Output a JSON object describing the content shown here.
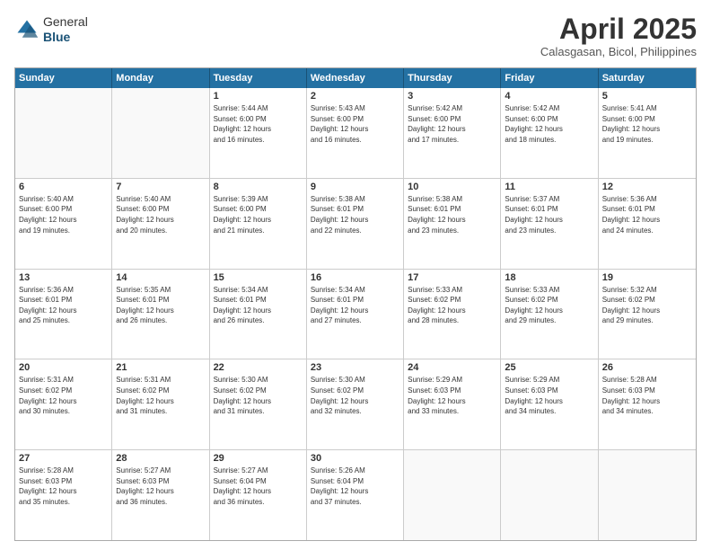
{
  "logo": {
    "general": "General",
    "blue": "Blue"
  },
  "header": {
    "month": "April 2025",
    "location": "Calasgasan, Bicol, Philippines"
  },
  "weekdays": [
    "Sunday",
    "Monday",
    "Tuesday",
    "Wednesday",
    "Thursday",
    "Friday",
    "Saturday"
  ],
  "rows": [
    [
      {
        "date": "",
        "info": ""
      },
      {
        "date": "",
        "info": ""
      },
      {
        "date": "1",
        "info": "Sunrise: 5:44 AM\nSunset: 6:00 PM\nDaylight: 12 hours\nand 16 minutes."
      },
      {
        "date": "2",
        "info": "Sunrise: 5:43 AM\nSunset: 6:00 PM\nDaylight: 12 hours\nand 16 minutes."
      },
      {
        "date": "3",
        "info": "Sunrise: 5:42 AM\nSunset: 6:00 PM\nDaylight: 12 hours\nand 17 minutes."
      },
      {
        "date": "4",
        "info": "Sunrise: 5:42 AM\nSunset: 6:00 PM\nDaylight: 12 hours\nand 18 minutes."
      },
      {
        "date": "5",
        "info": "Sunrise: 5:41 AM\nSunset: 6:00 PM\nDaylight: 12 hours\nand 19 minutes."
      }
    ],
    [
      {
        "date": "6",
        "info": "Sunrise: 5:40 AM\nSunset: 6:00 PM\nDaylight: 12 hours\nand 19 minutes."
      },
      {
        "date": "7",
        "info": "Sunrise: 5:40 AM\nSunset: 6:00 PM\nDaylight: 12 hours\nand 20 minutes."
      },
      {
        "date": "8",
        "info": "Sunrise: 5:39 AM\nSunset: 6:00 PM\nDaylight: 12 hours\nand 21 minutes."
      },
      {
        "date": "9",
        "info": "Sunrise: 5:38 AM\nSunset: 6:01 PM\nDaylight: 12 hours\nand 22 minutes."
      },
      {
        "date": "10",
        "info": "Sunrise: 5:38 AM\nSunset: 6:01 PM\nDaylight: 12 hours\nand 23 minutes."
      },
      {
        "date": "11",
        "info": "Sunrise: 5:37 AM\nSunset: 6:01 PM\nDaylight: 12 hours\nand 23 minutes."
      },
      {
        "date": "12",
        "info": "Sunrise: 5:36 AM\nSunset: 6:01 PM\nDaylight: 12 hours\nand 24 minutes."
      }
    ],
    [
      {
        "date": "13",
        "info": "Sunrise: 5:36 AM\nSunset: 6:01 PM\nDaylight: 12 hours\nand 25 minutes."
      },
      {
        "date": "14",
        "info": "Sunrise: 5:35 AM\nSunset: 6:01 PM\nDaylight: 12 hours\nand 26 minutes."
      },
      {
        "date": "15",
        "info": "Sunrise: 5:34 AM\nSunset: 6:01 PM\nDaylight: 12 hours\nand 26 minutes."
      },
      {
        "date": "16",
        "info": "Sunrise: 5:34 AM\nSunset: 6:01 PM\nDaylight: 12 hours\nand 27 minutes."
      },
      {
        "date": "17",
        "info": "Sunrise: 5:33 AM\nSunset: 6:02 PM\nDaylight: 12 hours\nand 28 minutes."
      },
      {
        "date": "18",
        "info": "Sunrise: 5:33 AM\nSunset: 6:02 PM\nDaylight: 12 hours\nand 29 minutes."
      },
      {
        "date": "19",
        "info": "Sunrise: 5:32 AM\nSunset: 6:02 PM\nDaylight: 12 hours\nand 29 minutes."
      }
    ],
    [
      {
        "date": "20",
        "info": "Sunrise: 5:31 AM\nSunset: 6:02 PM\nDaylight: 12 hours\nand 30 minutes."
      },
      {
        "date": "21",
        "info": "Sunrise: 5:31 AM\nSunset: 6:02 PM\nDaylight: 12 hours\nand 31 minutes."
      },
      {
        "date": "22",
        "info": "Sunrise: 5:30 AM\nSunset: 6:02 PM\nDaylight: 12 hours\nand 31 minutes."
      },
      {
        "date": "23",
        "info": "Sunrise: 5:30 AM\nSunset: 6:02 PM\nDaylight: 12 hours\nand 32 minutes."
      },
      {
        "date": "24",
        "info": "Sunrise: 5:29 AM\nSunset: 6:03 PM\nDaylight: 12 hours\nand 33 minutes."
      },
      {
        "date": "25",
        "info": "Sunrise: 5:29 AM\nSunset: 6:03 PM\nDaylight: 12 hours\nand 34 minutes."
      },
      {
        "date": "26",
        "info": "Sunrise: 5:28 AM\nSunset: 6:03 PM\nDaylight: 12 hours\nand 34 minutes."
      }
    ],
    [
      {
        "date": "27",
        "info": "Sunrise: 5:28 AM\nSunset: 6:03 PM\nDaylight: 12 hours\nand 35 minutes."
      },
      {
        "date": "28",
        "info": "Sunrise: 5:27 AM\nSunset: 6:03 PM\nDaylight: 12 hours\nand 36 minutes."
      },
      {
        "date": "29",
        "info": "Sunrise: 5:27 AM\nSunset: 6:04 PM\nDaylight: 12 hours\nand 36 minutes."
      },
      {
        "date": "30",
        "info": "Sunrise: 5:26 AM\nSunset: 6:04 PM\nDaylight: 12 hours\nand 37 minutes."
      },
      {
        "date": "",
        "info": ""
      },
      {
        "date": "",
        "info": ""
      },
      {
        "date": "",
        "info": ""
      }
    ]
  ]
}
